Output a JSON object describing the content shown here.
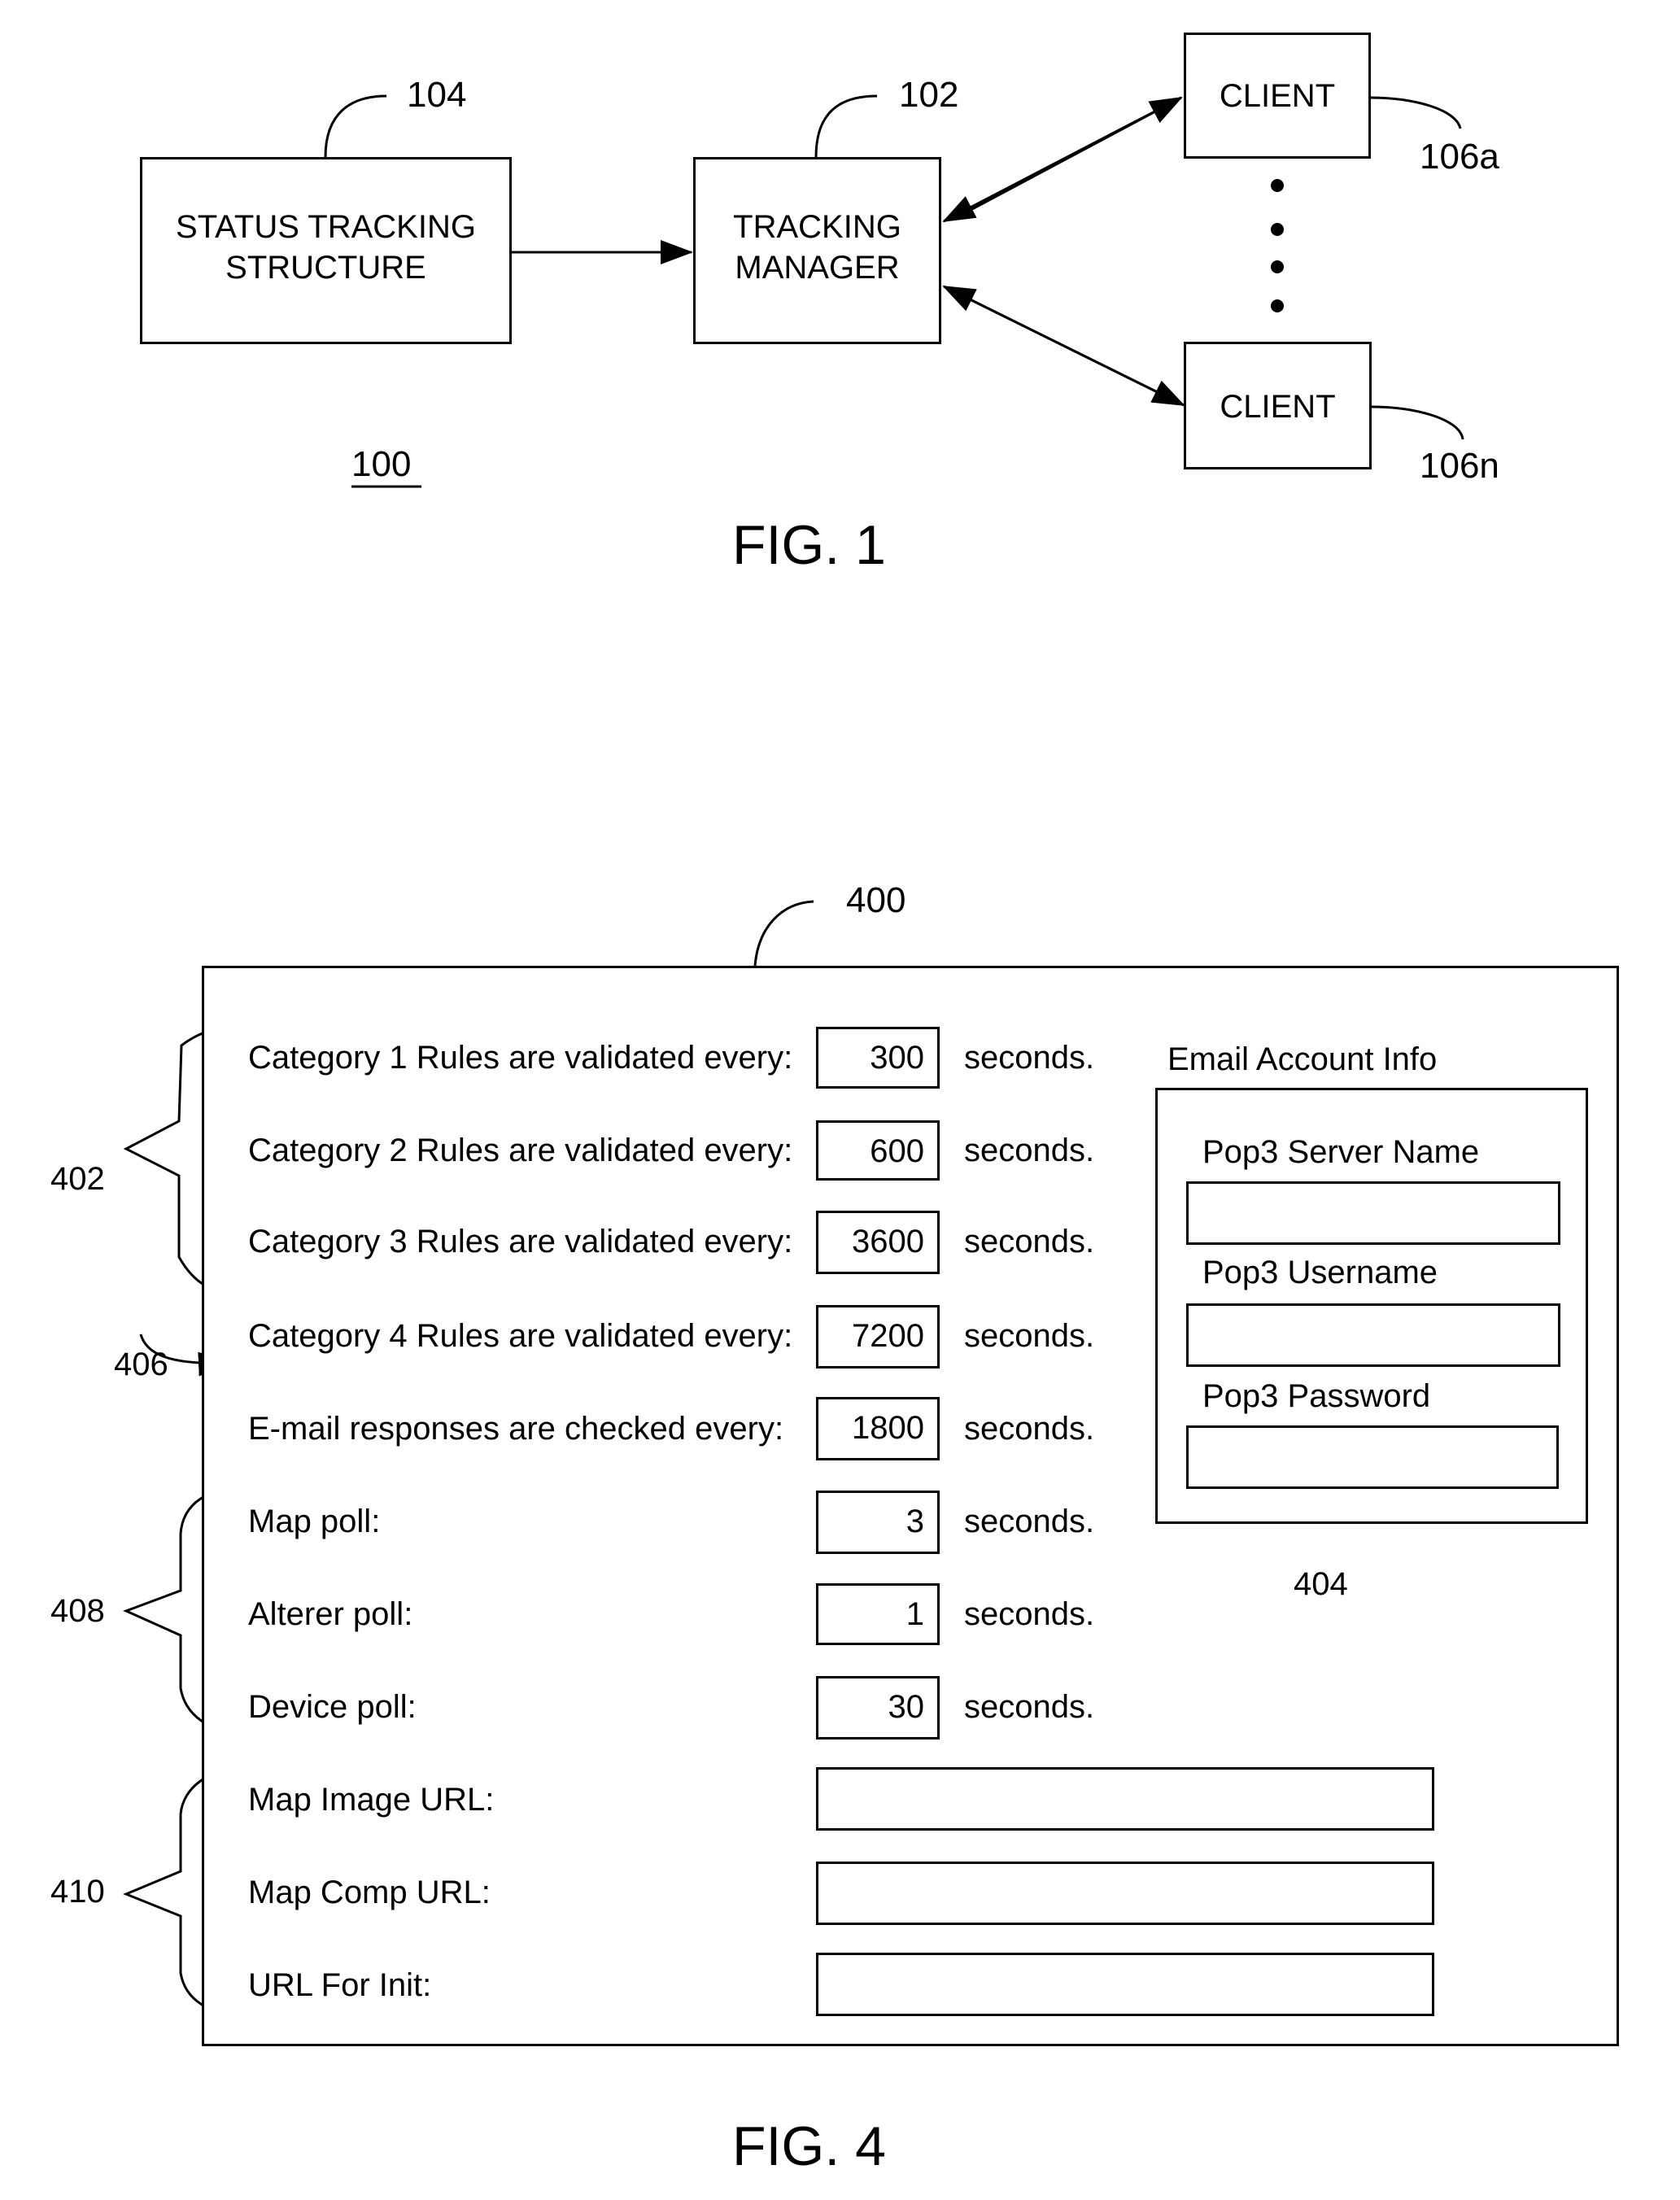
{
  "fig1": {
    "caption": "FIG. 1",
    "system_ref": "100",
    "status_tracking": {
      "ref": "104",
      "line1": "STATUS TRACKING",
      "line2": "STRUCTURE"
    },
    "tracking_manager": {
      "ref": "102",
      "line1": "TRACKING",
      "line2": "MANAGER"
    },
    "clients": [
      {
        "label": "CLIENT",
        "ref": "106a"
      },
      {
        "label": "CLIENT",
        "ref": "106n"
      }
    ]
  },
  "fig4": {
    "caption": "FIG. 4",
    "window_ref": "400",
    "group_refs": {
      "rules": "402",
      "email_account": "404",
      "email_check": "406",
      "polls": "408",
      "urls": "410"
    },
    "unit_label": "seconds.",
    "rules": [
      {
        "label": "Category 1 Rules are validated every:",
        "value": "300"
      },
      {
        "label": "Category 2 Rules are validated every:",
        "value": "600"
      },
      {
        "label": "Category 3 Rules are validated every:",
        "value": "3600"
      },
      {
        "label": "Category 4 Rules are validated every:",
        "value": "7200"
      }
    ],
    "email_check": {
      "label": "E-mail responses are checked every:",
      "value": "1800"
    },
    "polls": [
      {
        "label": "Map poll:",
        "value": "3"
      },
      {
        "label": "Alterer poll:",
        "value": "1"
      },
      {
        "label": "Device poll:",
        "value": "30"
      }
    ],
    "urls": [
      {
        "label": "Map Image URL:",
        "value": ""
      },
      {
        "label": "Map Comp URL:",
        "value": ""
      },
      {
        "label": "URL For Init:",
        "value": ""
      }
    ],
    "email_account": {
      "title": "Email Account Info",
      "fields": [
        {
          "label": "Pop3 Server Name",
          "value": ""
        },
        {
          "label": "Pop3 Username",
          "value": ""
        },
        {
          "label": "Pop3 Password",
          "value": ""
        }
      ]
    }
  }
}
